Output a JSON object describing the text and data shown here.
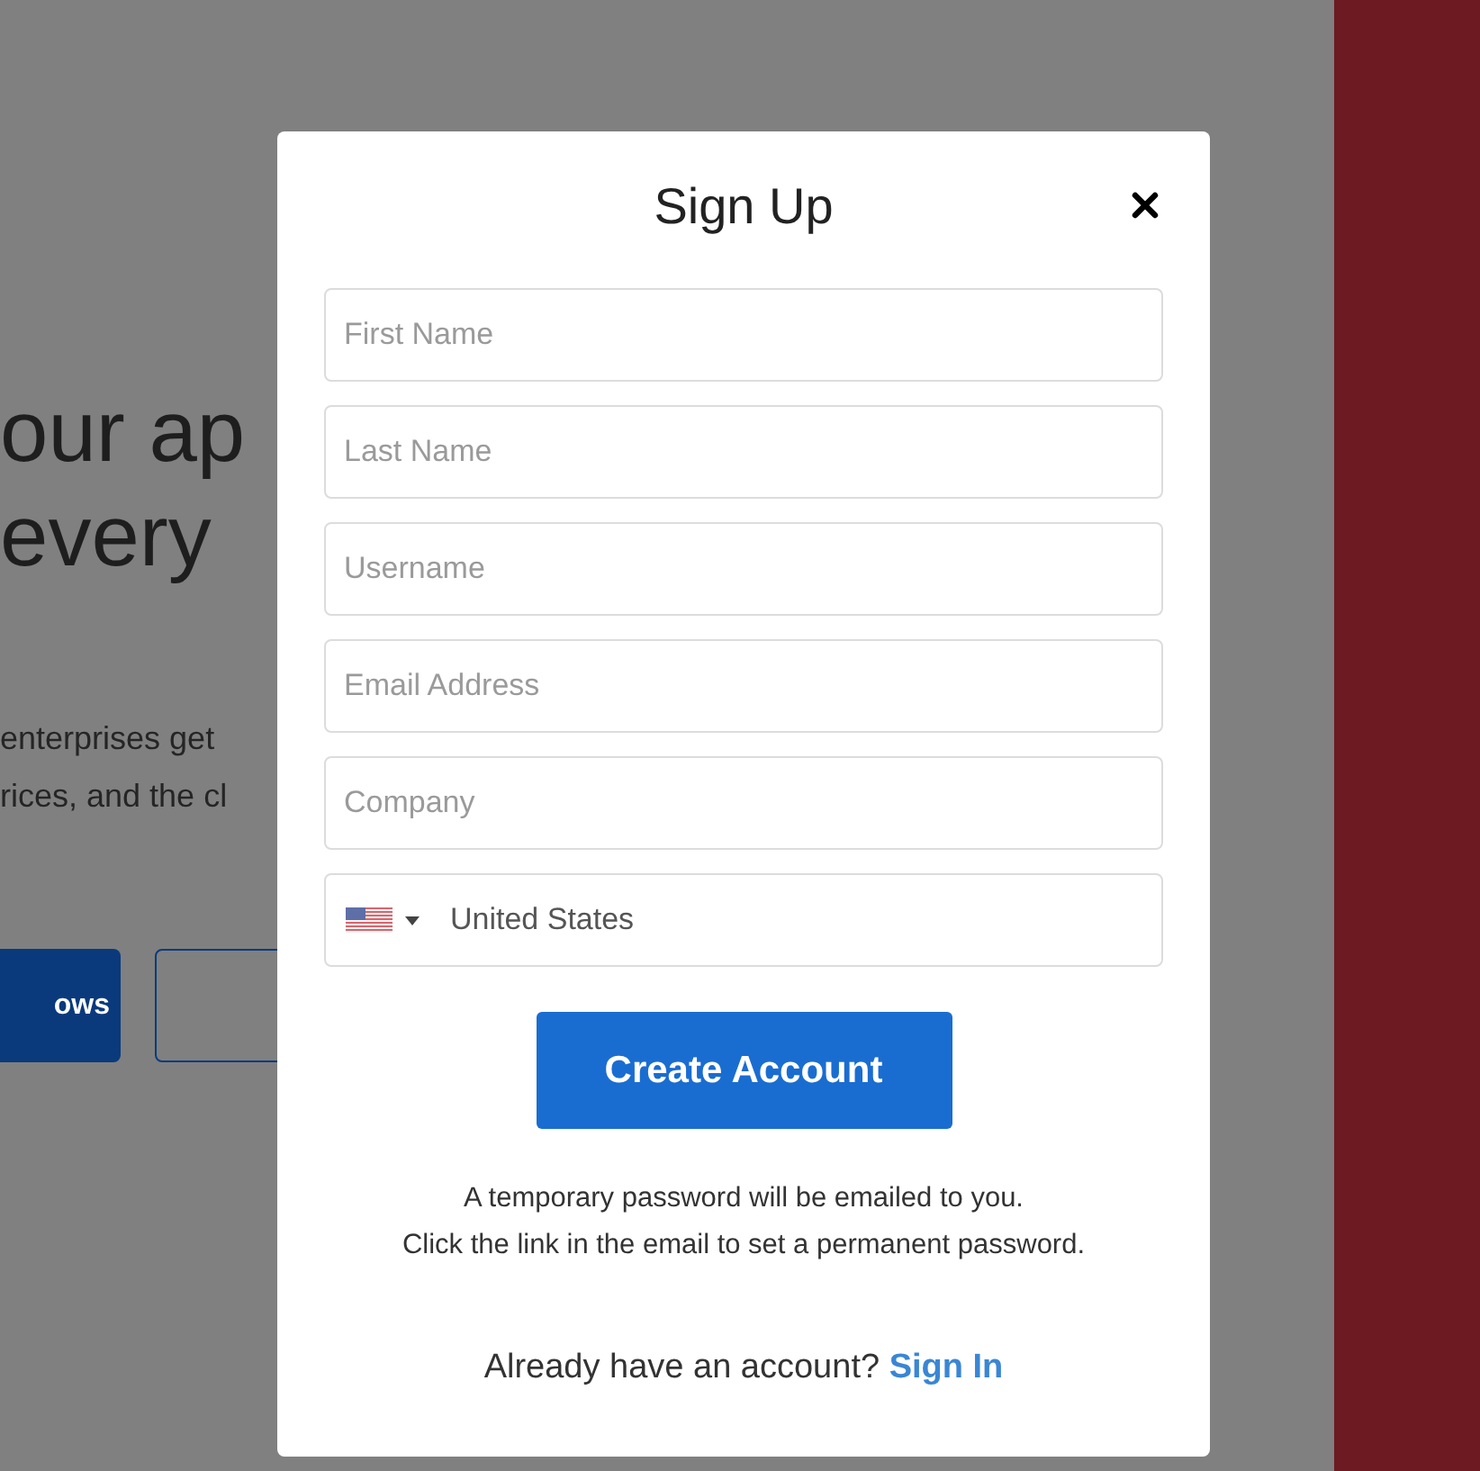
{
  "background": {
    "headline": [
      "our ap",
      "every"
    ],
    "paragraph": [
      "enterprises get",
      "rices, and the cl"
    ],
    "primary_button": {
      "label": "ows"
    }
  },
  "dialog": {
    "title": "Sign Up",
    "fields": [
      {
        "kind": "text",
        "placeholder": "First Name"
      },
      {
        "kind": "text",
        "placeholder": "Last Name"
      },
      {
        "kind": "text",
        "placeholder": "Username"
      },
      {
        "kind": "text",
        "placeholder": "Email Address"
      },
      {
        "kind": "text",
        "placeholder": "Company"
      },
      {
        "kind": "country",
        "value": "United States"
      }
    ],
    "submit": "Create Account",
    "note": [
      "A temporary password will be emailed to you.",
      "Click the link in the email to set a permanent password."
    ],
    "sign_in": {
      "prompt": "Already have an account?",
      "link": "Sign In"
    }
  }
}
